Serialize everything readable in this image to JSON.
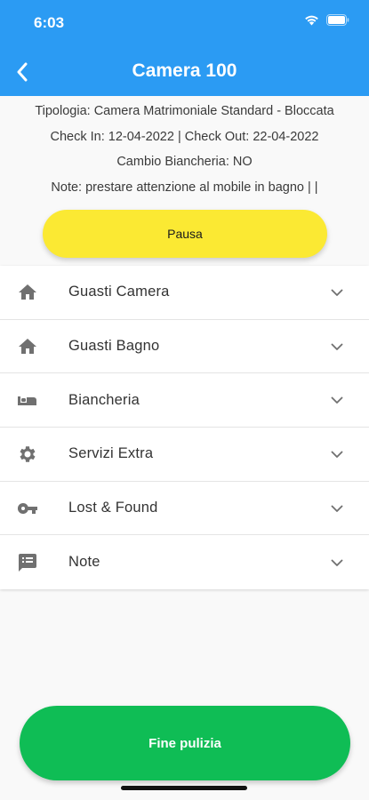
{
  "status_bar": {
    "time": "6:03",
    "wifi_icon": "wifi-icon",
    "battery_icon": "battery-icon"
  },
  "header": {
    "title": "Camera 100",
    "back_icon": "chevron-left-icon"
  },
  "info": {
    "type_line": "Tipologia: Camera Matrimoniale Standard - Bloccata",
    "dates_line": "Check In: 12-04-2022 | Check Out: 22-04-2022",
    "linen_line": "Cambio Biancheria: NO",
    "notes_line": "Note: prestare attenzione al mobile in bagno |  |"
  },
  "pause_button": {
    "label": "Pausa",
    "color": "#fbe933"
  },
  "sections": [
    {
      "label": "Guasti Camera",
      "icon": "home-icon"
    },
    {
      "label": "Guasti Bagno",
      "icon": "home-icon"
    },
    {
      "label": "Biancheria",
      "icon": "bed-icon"
    },
    {
      "label": "Servizi Extra",
      "icon": "gear-icon"
    },
    {
      "label": "Lost & Found",
      "icon": "key-icon"
    },
    {
      "label": "Note",
      "icon": "notes-icon"
    }
  ],
  "finish_button": {
    "label": "Fine pulizia",
    "color": "#0fbd55"
  },
  "colors": {
    "header": "#2b9bf3",
    "icon_gray": "#707070"
  }
}
